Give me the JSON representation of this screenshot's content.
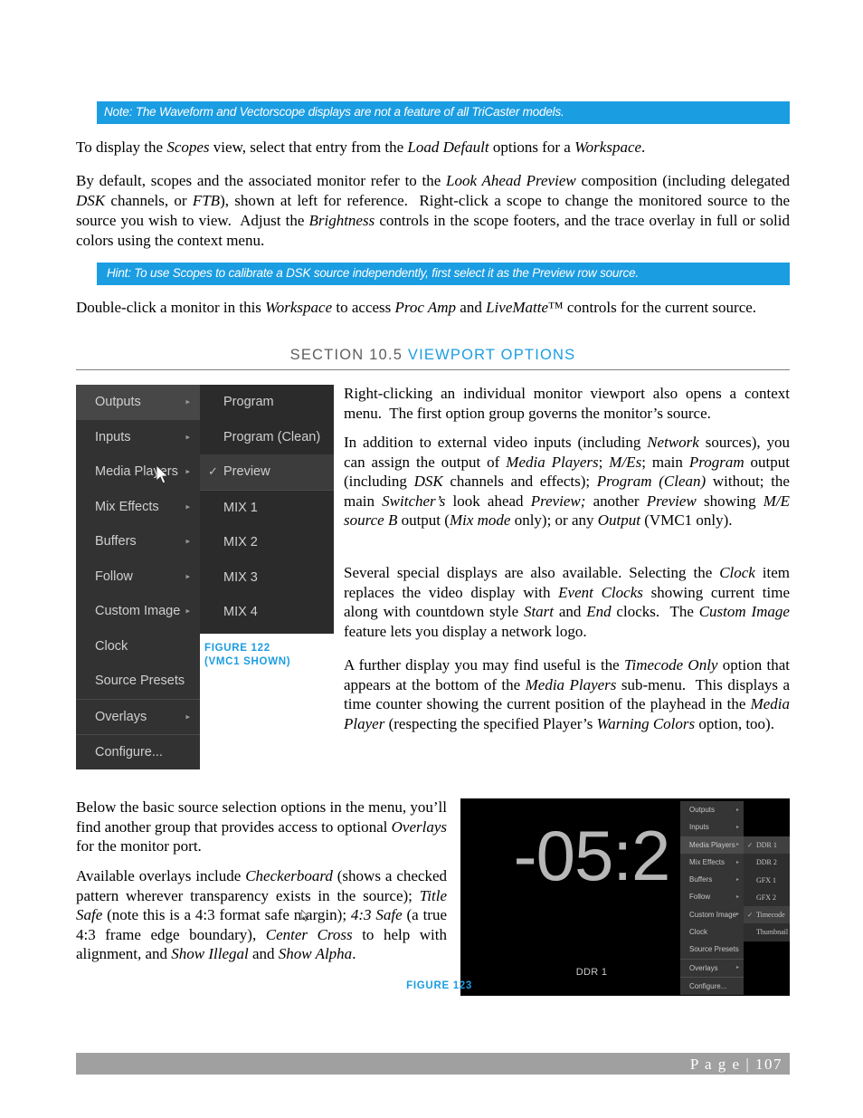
{
  "callouts": {
    "note": "Note: The Waveform and Vectorscope displays are not a feature of all TriCaster models.",
    "hint": "Hint: To use Scopes to calibrate a DSK source independently, first select it as the Preview row source."
  },
  "paragraphs": {
    "scopes": "To display the Scopes view, select that entry from the Load Default options for a Workspace.",
    "default": "By default, scopes and the associated monitor refer to the Look Ahead Preview composition (including delegated DSK channels, or FTB), shown at left for reference.  Right-click a scope to change the monitored source to the source you wish to view.  Adjust the Brightness controls in the scope footers, and the trace overlay in full or solid colors using the context menu.",
    "dblclick": "Double-click a monitor in this Workspace to access Proc Amp and LiveMatte™ controls for the current source."
  },
  "section": {
    "number": "SECTION 10.5",
    "name": "VIEWPORT OPTIONS"
  },
  "figure122": {
    "caption_line1": "FIGURE 122",
    "caption_line2": "(VMC1 SHOWN)",
    "menu_items": [
      {
        "label": "Outputs",
        "arrow": "▸",
        "highlighted": true
      },
      {
        "label": "Inputs",
        "arrow": "▸",
        "highlighted": false
      },
      {
        "label": "Media Players",
        "arrow": "▸",
        "highlighted": false
      },
      {
        "label": "Mix Effects",
        "arrow": "▸",
        "highlighted": false
      },
      {
        "label": "Buffers",
        "arrow": "▸",
        "highlighted": false
      },
      {
        "label": "Follow",
        "arrow": "▸",
        "highlighted": false
      },
      {
        "label": "Custom Image",
        "arrow": "▸",
        "highlighted": false
      },
      {
        "label": "Clock",
        "arrow": "",
        "highlighted": false
      },
      {
        "label": "Source Presets",
        "arrow": "",
        "highlighted": false
      },
      {
        "label": "Overlays",
        "arrow": "▸",
        "highlighted": false
      },
      {
        "label": "Configure...",
        "arrow": "",
        "highlighted": false
      }
    ],
    "submenu_items": [
      {
        "label": "Program",
        "check": "",
        "highlighted": false
      },
      {
        "label": "Program (Clean)",
        "check": "",
        "highlighted": false
      },
      {
        "label": "Preview",
        "check": "✓",
        "highlighted": true
      },
      {
        "label": "MIX 1",
        "check": "",
        "highlighted": false
      },
      {
        "label": "MIX 2",
        "check": "",
        "highlighted": false
      },
      {
        "label": "MIX 3",
        "check": "",
        "highlighted": false
      },
      {
        "label": "MIX 4",
        "check": "",
        "highlighted": false
      }
    ]
  },
  "right_column": {
    "p1": "Right-clicking an individual monitor viewport also opens a context menu.  The first option group governs the monitor’s source.",
    "p2": "In addition to external video inputs (including Network sources), you can assign the output of Media Players; M/Es; main Program output (including DSK channels and effects); Program (Clean) without; the main Switcher’s look ahead Preview; another Preview showing M/E source B output (Mix mode only); or any Output (VMC1 only).",
    "p3": "Several special displays are also available. Selecting the Clock item replaces the video display with Event Clocks showing current time along with countdown style Start and End clocks.   The Custom Image feature lets you display a network logo.",
    "p4": "A further display you may find useful is the Timecode Only option that appears at the bottom of the Media Players sub-menu.  This displays a time counter showing the current position of the playhead in the Media Player (respecting the specified Player’s Warning Colors option, too)."
  },
  "left_column": {
    "p1": "Below the basic source selection options in the menu, you’ll find another group that provides access to optional Overlays for the monitor port.",
    "p2": "Available overlays include Checkerboard (shows a checked pattern wherever transparency exists in the source); Title Safe (note this is a 4:3 format safe margin); 4:3 Safe (a true 4:3 frame edge boundary), Center Cross to help with alignment, and Show Illegal and Show Alpha."
  },
  "figure123": {
    "caption": "FIGURE 123",
    "timecode": "-05:2",
    "source_label": "DDR 1",
    "menu_items": [
      {
        "label": "Outputs",
        "arrow": "▸",
        "highlighted": false
      },
      {
        "label": "Inputs",
        "arrow": "▸",
        "highlighted": false
      },
      {
        "label": "Media Players",
        "arrow": "▸",
        "highlighted": true
      },
      {
        "label": "Mix Effects",
        "arrow": "▸",
        "highlighted": false
      },
      {
        "label": "Buffers",
        "arrow": "▸",
        "highlighted": false
      },
      {
        "label": "Follow",
        "arrow": "▸",
        "highlighted": false
      },
      {
        "label": "Custom Image",
        "arrow": "▸",
        "highlighted": false
      },
      {
        "label": "Clock",
        "arrow": "",
        "highlighted": false
      },
      {
        "label": "Source Presets",
        "arrow": "",
        "highlighted": false
      },
      {
        "label": "Overlays",
        "arrow": "▸",
        "highlighted": false
      },
      {
        "label": "Configure...",
        "arrow": "",
        "highlighted": false
      }
    ],
    "submenu_items": [
      {
        "label": "DDR 1",
        "check": "✓",
        "highlighted": true
      },
      {
        "label": "DDR 2",
        "check": "",
        "highlighted": false
      },
      {
        "label": "GFX 1",
        "check": "",
        "highlighted": false
      },
      {
        "label": "GFX 2",
        "check": "",
        "highlighted": false
      },
      {
        "label": "Timecode",
        "check": "✓",
        "highlighted": true
      },
      {
        "label": "Thumbnail",
        "check": "",
        "highlighted": false
      }
    ]
  },
  "footer": {
    "page_label": "P a g e  | 107"
  },
  "colors": {
    "accent_blue": "#1b9de2",
    "menu_bg": "#323232",
    "footer_gray": "#a0a0a0"
  }
}
